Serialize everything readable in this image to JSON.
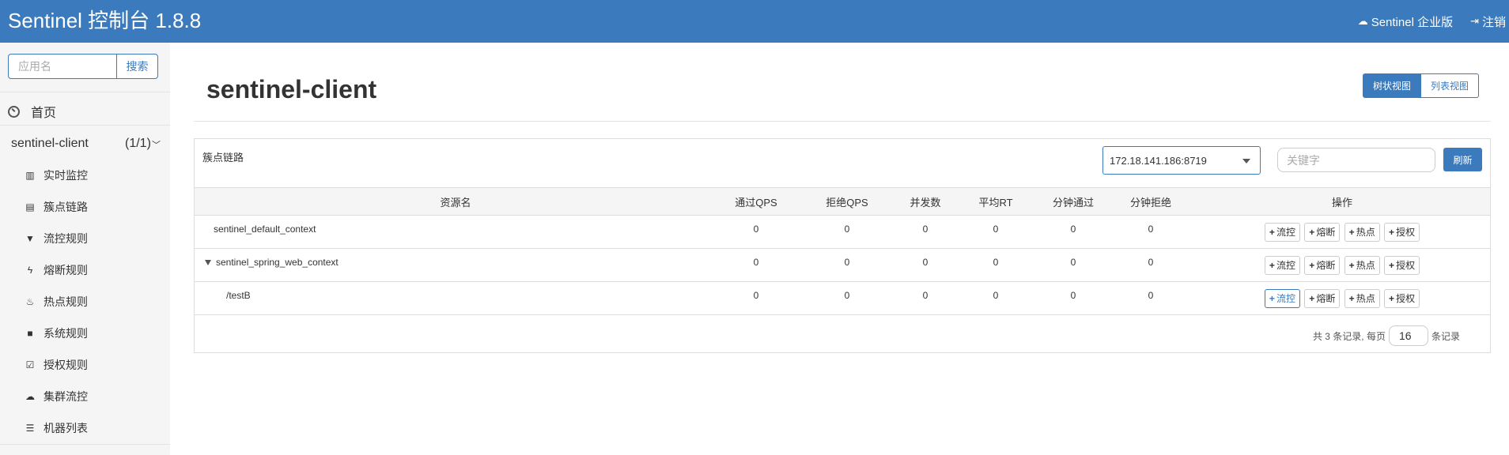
{
  "header": {
    "title": "Sentinel 控制台 1.8.8",
    "enterprise_link": "Sentinel 企业版",
    "logout_link": "注销",
    "color": "#3b7bbd"
  },
  "sidebar": {
    "search_placeholder": "应用名",
    "search_button": "搜索",
    "home_label": "首页",
    "app_name": "sentinel-client",
    "app_count": "(1/1)",
    "menu": [
      {
        "label": "实时监控",
        "icon": "bar-chart-icon"
      },
      {
        "label": "簇点链路",
        "icon": "list-alt-icon"
      },
      {
        "label": "流控规则",
        "icon": "filter-icon"
      },
      {
        "label": "熔断规则",
        "icon": "flash-icon"
      },
      {
        "label": "热点规则",
        "icon": "fire-icon"
      },
      {
        "label": "系统规则",
        "icon": "lock-icon"
      },
      {
        "label": "授权规则",
        "icon": "check-icon"
      },
      {
        "label": "集群流控",
        "icon": "cloud-icon"
      },
      {
        "label": "机器列表",
        "icon": "th-list-icon"
      }
    ]
  },
  "main": {
    "page_title": "sentinel-client",
    "view_tree": "树状视图",
    "view_list": "列表视图",
    "panel_title": "簇点链路",
    "machine_select": "172.18.141.186:8719",
    "keyword_placeholder": "关键字",
    "refresh_button": "刷新",
    "columns": [
      "资源名",
      "通过QPS",
      "拒绝QPS",
      "并发数",
      "平均RT",
      "分钟通过",
      "分钟拒绝",
      "操作"
    ],
    "rows": [
      {
        "name": "sentinel_default_context",
        "values": [
          "0",
          "0",
          "0",
          "0",
          "0",
          "0"
        ]
      },
      {
        "name": "sentinel_spring_web_context",
        "values": [
          "0",
          "0",
          "0",
          "0",
          "0",
          "0"
        ]
      },
      {
        "name": "/testB",
        "values": [
          "0",
          "0",
          "0",
          "0",
          "0",
          "0"
        ]
      }
    ],
    "ops": [
      "流控",
      "熔断",
      "热点",
      "授权"
    ],
    "pager": {
      "summary": "共 3 条记录, 每页",
      "page_size": "16",
      "suffix": "条记录"
    }
  }
}
